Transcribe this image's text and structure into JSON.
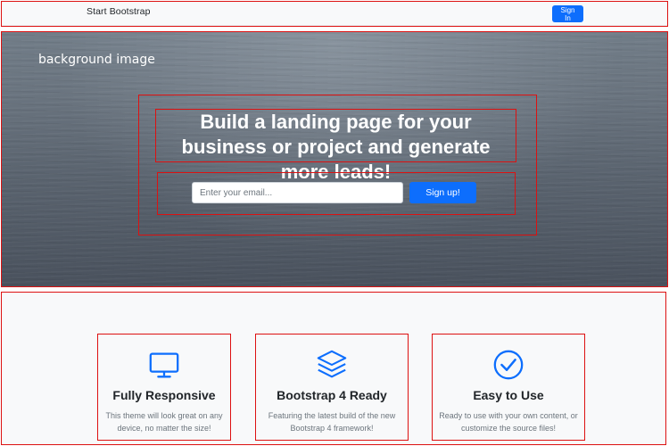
{
  "navbar": {
    "brand": "Start Bootstrap",
    "signin_label": "Sign In"
  },
  "hero": {
    "background_label": "background image",
    "headline": "Build a landing page for your business or project and generate more leads!",
    "email_placeholder": "Enter your email...",
    "signup_label": "Sign up!"
  },
  "features": [
    {
      "icon": "monitor-icon",
      "title": "Fully Responsive",
      "description": "This theme will look great on any device, no matter the size!"
    },
    {
      "icon": "layers-icon",
      "title": "Bootstrap 4 Ready",
      "description": "Featuring the latest build of the new Bootstrap 4 framework!"
    },
    {
      "icon": "check-circle-icon",
      "title": "Easy to Use",
      "description": "Ready to use with your own content, or customize the source files!"
    }
  ],
  "colors": {
    "primary": "#0d6efd",
    "annotation": "#dd1111",
    "features_bg": "#f8f9fa"
  }
}
